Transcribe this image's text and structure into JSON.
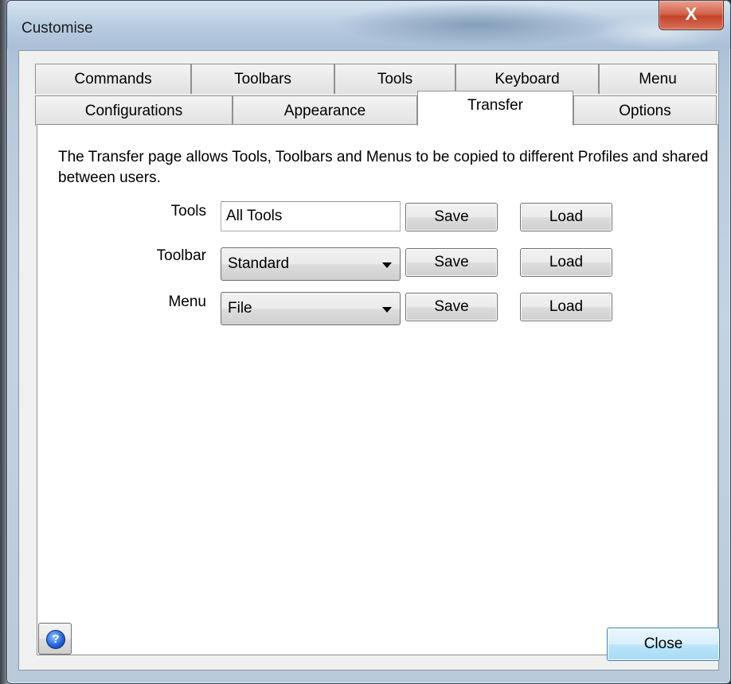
{
  "window": {
    "title": "Customise",
    "close_glyph": "X"
  },
  "tabs_row1": [
    {
      "label": "Commands"
    },
    {
      "label": "Toolbars"
    },
    {
      "label": "Tools"
    },
    {
      "label": "Keyboard"
    },
    {
      "label": "Menu"
    }
  ],
  "tabs_row2": [
    {
      "label": "Configurations"
    },
    {
      "label": "Appearance"
    },
    {
      "label": "Transfer",
      "active": true
    },
    {
      "label": "Options"
    }
  ],
  "transfer": {
    "description": "The Transfer page allows Tools, Toolbars and Menus to be copied to different Profiles and shared between users.",
    "rows": [
      {
        "label": "Tools",
        "kind": "text",
        "value": "All Tools",
        "save": "Save",
        "load": "Load"
      },
      {
        "label": "Toolbar",
        "kind": "combo",
        "value": "Standard",
        "save": "Save",
        "load": "Load"
      },
      {
        "label": "Menu",
        "kind": "combo",
        "value": "File",
        "save": "Save",
        "load": "Load"
      }
    ]
  },
  "footer": {
    "help_icon": "help-icon",
    "help_glyph": "?",
    "close_label": "Close"
  },
  "colors": {
    "title_close": "#c4432a",
    "default_button": "#3c7fb1"
  }
}
